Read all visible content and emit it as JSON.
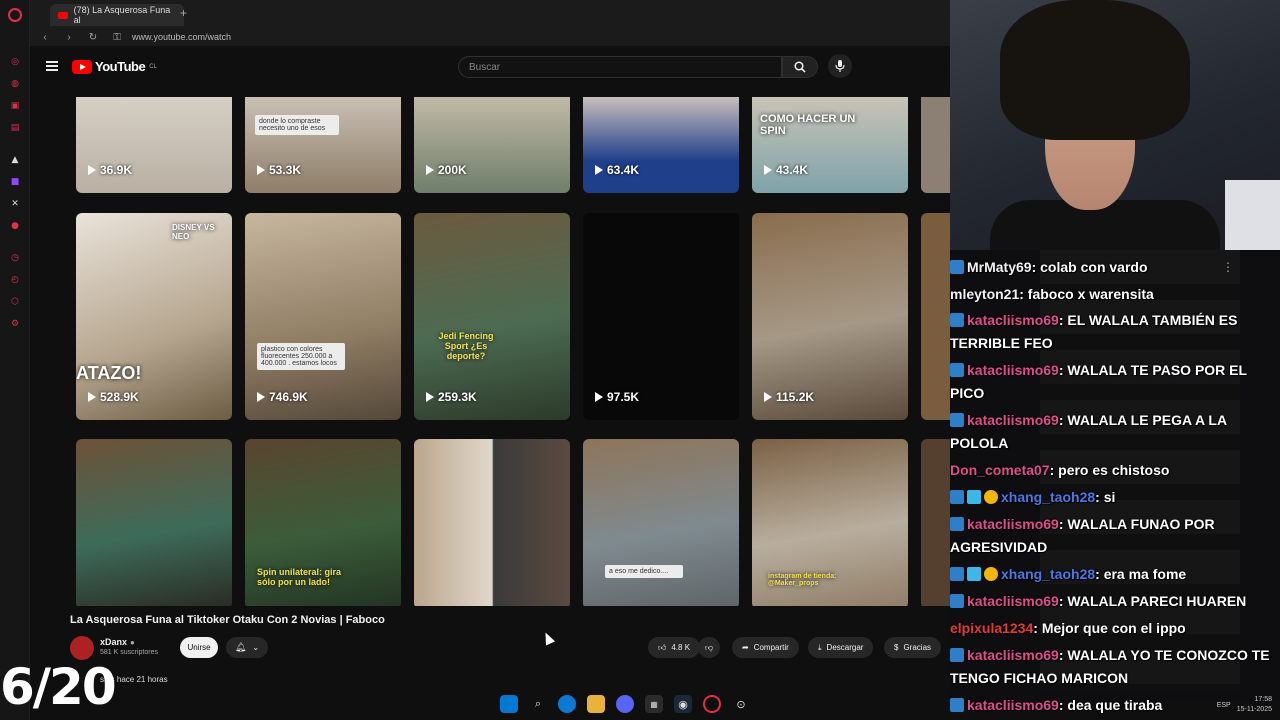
{
  "browser": {
    "tab_title": "(78) La Asquerosa Funa al",
    "url": "www.youtube.com/watch"
  },
  "youtube": {
    "logo_text": "YouTube",
    "region": "CL",
    "search_placeholder": "Buscar"
  },
  "thumbnails": [
    {
      "views": "36.9K"
    },
    {
      "views": "53.3K"
    },
    {
      "views": "200K"
    },
    {
      "views": "63.4K"
    },
    {
      "views": "43.4K"
    },
    {
      "views": "528.9K"
    },
    {
      "views": "746.9K"
    },
    {
      "views": "259.3K"
    },
    {
      "views": "97.5K"
    },
    {
      "views": "115.2K"
    }
  ],
  "thumb_overlays": {
    "t2": "donde lo compraste necesito uno de esos",
    "t5": "COMO HACER UN SPIN",
    "t6": "ATAZO!",
    "t6b": "DISNEY VS NEO",
    "t7": "plastico con colores fluorecentes 250.000 a 400.000 . estamos locos",
    "t8": "Jedi Fencing Sport ¿Es deporte?",
    "t12": "Spin unilateral: gira sólo por un lado!",
    "t14": "a eso me dedico....",
    "t15": "instagram de tienda: @Maker_props"
  },
  "video": {
    "title": "La Asquerosa Funa al Tiktoker Otaku Con 2 Novias | Faboco",
    "channel": "xDanx",
    "subscribers": "581 K suscriptores",
    "join_label": "Unirse",
    "likes": "4.8 K",
    "share_label": "Compartir",
    "download_label": "Descargar",
    "thanks_label": "Gracias",
    "views_line": "stas  hace 21 horas"
  },
  "overlay_counter": "6/20",
  "chat": [
    {
      "user": "MrMaty69",
      "text": ": colab con vardo",
      "badges": [
        "sub"
      ],
      "color": "white"
    },
    {
      "user": "mleyton21",
      "text": ": faboco x warensita",
      "badges": [],
      "color": "white"
    },
    {
      "user": "katacliismo69",
      "text": ": EL WALALA TAMBIÉN ES TERRIBLE FEO",
      "badges": [
        "sub"
      ],
      "color": "pink"
    },
    {
      "user": "katacliismo69",
      "text": ": WALALA TE PASO POR EL PICO",
      "badges": [
        "sub"
      ],
      "color": "pink"
    },
    {
      "user": "katacliismo69",
      "text": ": WALALA LE PEGA A LA POLOLA",
      "badges": [
        "sub"
      ],
      "color": "pink"
    },
    {
      "user": "Don_cometa07",
      "text": ": pero es chistoso",
      "badges": [],
      "color": "pink"
    },
    {
      "user": "xhang_taoh28",
      "text": ": si",
      "badges": [
        "sub",
        "gem",
        "gold"
      ],
      "color": "blue"
    },
    {
      "user": "katacliismo69",
      "text": ": WALALA FUNAO POR AGRESIVIDAD",
      "badges": [
        "sub"
      ],
      "color": "pink"
    },
    {
      "user": "xhang_taoh28",
      "text": ": era ma fome",
      "badges": [
        "sub",
        "gem",
        "gold"
      ],
      "color": "blue"
    },
    {
      "user": "katacliismo69",
      "text": ": WALALA PARECI HUAREN",
      "badges": [
        "sub"
      ],
      "color": "pink"
    },
    {
      "user": "elpixula1234",
      "text": ": Mejor que con el ippo",
      "badges": [],
      "color": "red"
    },
    {
      "user": "katacliismo69",
      "text": ": WALALA YO TE CONOZCO TE TENGO FICHAO MARICON",
      "badges": [
        "sub"
      ],
      "color": "pink"
    },
    {
      "user": "katacliismo69",
      "text": ": dea que tiraba",
      "badges": [
        "sub"
      ],
      "color": "pink"
    }
  ],
  "tray": {
    "lang": "ESP",
    "time": "17:58",
    "date": "15-11-2025"
  }
}
